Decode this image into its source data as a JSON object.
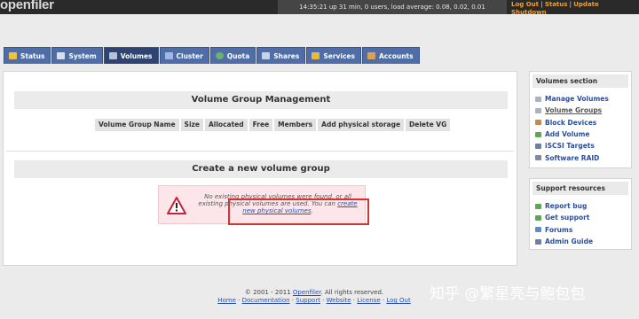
{
  "header": {
    "logo": "openfiler",
    "status": "14:35:21 up 31 min, 0 users, load average: 0.08, 0.02, 0.01",
    "links": {
      "logout": "Log Out",
      "sep1": " | ",
      "status": "Status",
      "sep2": " | ",
      "update": "Update",
      "shutdown": "Shutdown"
    }
  },
  "tabs": [
    {
      "label": "Status",
      "icon": "status-icon",
      "color": "#e8c24a"
    },
    {
      "label": "System",
      "icon": "system-icon",
      "color": "#d7e0ee"
    },
    {
      "label": "Volumes",
      "icon": "volumes-icon",
      "color": "#b7c2d6"
    },
    {
      "label": "Cluster",
      "icon": "cluster-icon",
      "color": "#9fb6e6"
    },
    {
      "label": "Quota",
      "icon": "quota-icon",
      "color": "#6bb36a"
    },
    {
      "label": "Shares",
      "icon": "shares-icon",
      "color": "#c9d2e2"
    },
    {
      "label": "Services",
      "icon": "services-icon",
      "color": "#e8b93a"
    },
    {
      "label": "Accounts",
      "icon": "accounts-icon",
      "color": "#d9a25a"
    }
  ],
  "main": {
    "vg_title": "Volume Group Management",
    "columns": [
      "Volume Group Name",
      "Size",
      "Allocated",
      "Free",
      "Members",
      "Add physical storage",
      "Delete VG"
    ],
    "create_title": "Create a new volume group",
    "notice_text": "No existing physical volumes were found, or all existing physical volumes are used. You can ",
    "notice_link": "create new physical volumes",
    "notice_end": "."
  },
  "volumes_section": {
    "title": "Volumes section",
    "items": [
      "Manage Volumes",
      "Volume Groups",
      "Block Devices",
      "Add Volume",
      "iSCSI Targets",
      "Software RAID"
    ]
  },
  "support_section": {
    "title": "Support resources",
    "items": [
      "Report bug",
      "Get support",
      "Forums",
      "Admin Guide"
    ]
  },
  "footer": {
    "copyright_prefix": "© 2001 - 2011 ",
    "brand": "Openfiler",
    "copyright_suffix": ". All rights reserved.",
    "links": [
      "Home",
      "Documentation",
      "Support",
      "Website",
      "License",
      "Log Out"
    ]
  },
  "watermark": "知乎 @繁星亮与鲍包包",
  "colors": {
    "tab_blue": "#4f6ea8",
    "tab_active": "#2f4470",
    "link_blue": "#2a52b0",
    "accent_orange": "#f0a02a",
    "highlight_red": "#d9332f"
  }
}
